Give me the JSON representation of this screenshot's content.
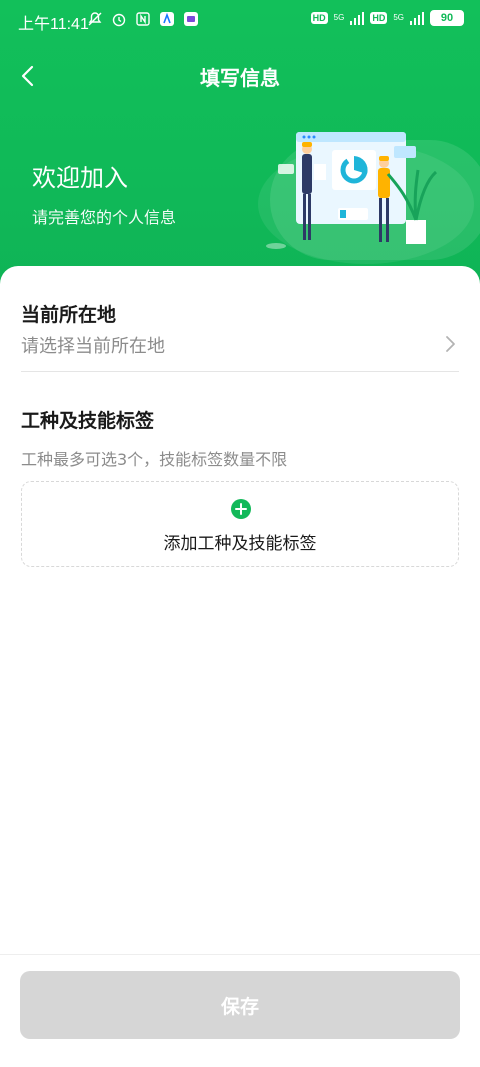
{
  "status_bar": {
    "time": "上午11:41",
    "network_1": "5G",
    "network_2": "5G",
    "hd_1": "HD",
    "hd_2": "HD",
    "battery": "90",
    "icons": [
      "mute-icon",
      "alarm-icon",
      "nfc-icon",
      "app-icon",
      "app-icon-2"
    ]
  },
  "nav": {
    "title": "填写信息",
    "back_icon": "chevron-left-icon"
  },
  "welcome": {
    "title": "欢迎加入",
    "subtitle": "请完善您的个人信息"
  },
  "location": {
    "title": "当前所在地",
    "placeholder": "请选择当前所在地"
  },
  "skills": {
    "title": "工种及技能标签",
    "hint": "工种最多可选3个，技能标签数量不限",
    "add_label": "添加工种及技能标签"
  },
  "footer": {
    "save_label": "保存"
  },
  "colors": {
    "brand_green": "#12c05a",
    "accent_green": "#13b95a",
    "disabled_gray": "#d6d6d6"
  }
}
